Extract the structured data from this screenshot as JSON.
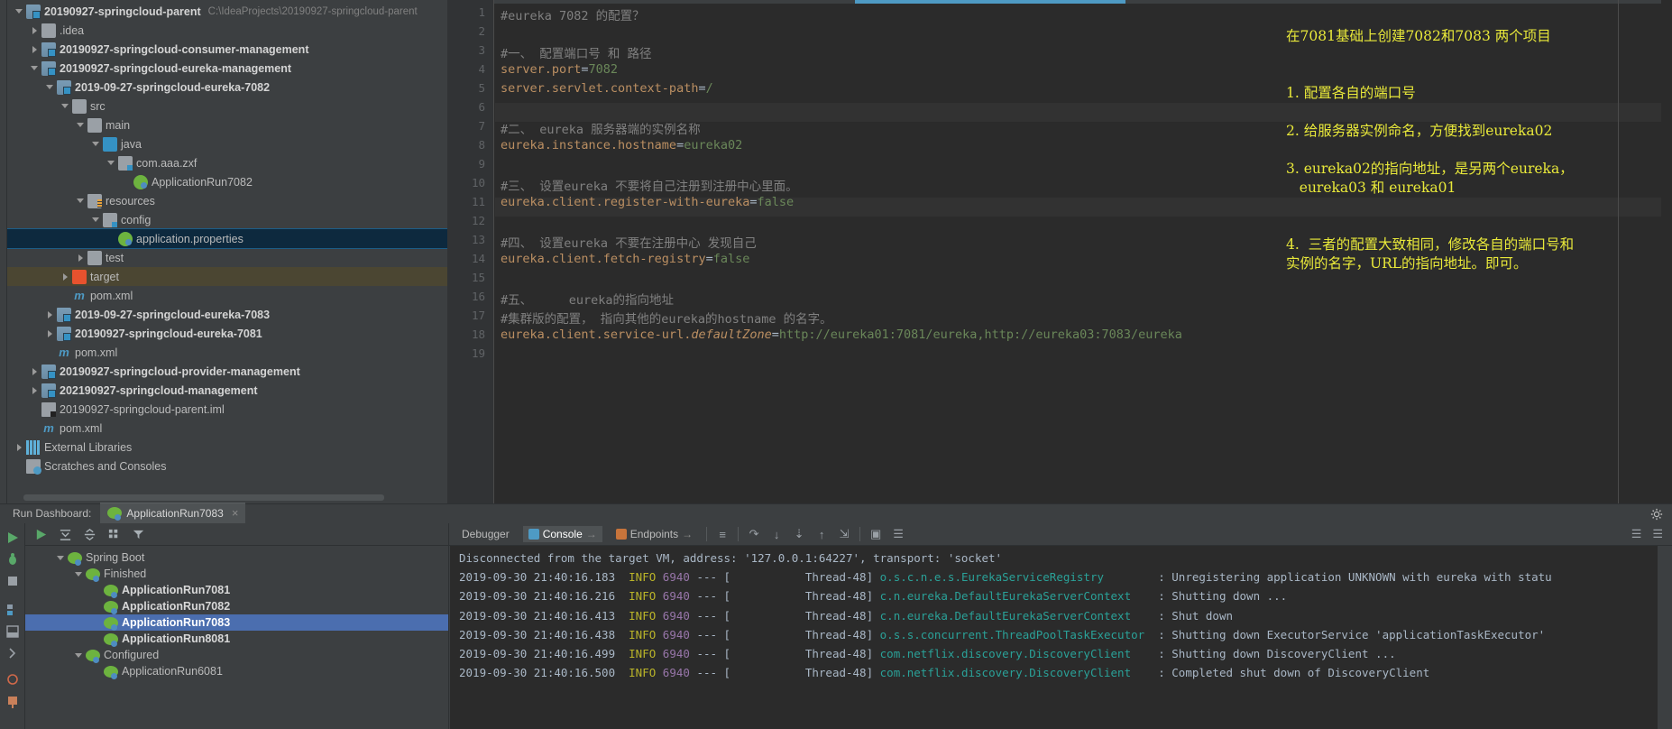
{
  "project_tree": [
    {
      "depth": 0,
      "twist": "d",
      "icon": "module-folder-icon",
      "label": "20190927-springcloud-parent",
      "bold": true,
      "path": "C:\\IdeaProjects\\20190927-springcloud-parent"
    },
    {
      "depth": 1,
      "twist": "r",
      "icon": "folder-icon",
      "label": ".idea",
      "bold": false
    },
    {
      "depth": 1,
      "twist": "r",
      "icon": "module-folder-icon",
      "label": "20190927-springcloud-consumer-management",
      "bold": true
    },
    {
      "depth": 1,
      "twist": "d",
      "icon": "module-folder-icon",
      "label": "20190927-springcloud-eureka-management",
      "bold": true
    },
    {
      "depth": 2,
      "twist": "d",
      "icon": "module-folder-icon",
      "label": "2019-09-27-springcloud-eureka-7082",
      "bold": true
    },
    {
      "depth": 3,
      "twist": "d",
      "icon": "folder-icon",
      "label": "src",
      "bold": false
    },
    {
      "depth": 4,
      "twist": "d",
      "icon": "folder-icon",
      "label": "main",
      "bold": false
    },
    {
      "depth": 5,
      "twist": "d",
      "icon": "java-source-folder-icon",
      "label": "java",
      "bold": false
    },
    {
      "depth": 6,
      "twist": "d",
      "icon": "package-icon",
      "label": "com.aaa.zxf",
      "bold": false
    },
    {
      "depth": 7,
      "twist": "",
      "icon": "spring-class-icon",
      "label": "ApplicationRun7082",
      "bold": false
    },
    {
      "depth": 4,
      "twist": "d",
      "icon": "resources-folder-icon",
      "label": "resources",
      "bold": false
    },
    {
      "depth": 5,
      "twist": "d",
      "icon": "package-icon",
      "label": "config",
      "bold": false
    },
    {
      "depth": 6,
      "twist": "",
      "icon": "properties-file-icon",
      "label": "application.properties",
      "bold": false,
      "state": "selected"
    },
    {
      "depth": 4,
      "twist": "r",
      "icon": "folder-icon",
      "label": "test",
      "bold": false
    },
    {
      "depth": 3,
      "twist": "r",
      "icon": "target-folder-icon",
      "label": "target",
      "bold": false,
      "state": "excluded"
    },
    {
      "depth": 3,
      "twist": "",
      "icon": "maven-pom-icon",
      "label": "pom.xml",
      "bold": false
    },
    {
      "depth": 2,
      "twist": "r",
      "icon": "module-folder-icon",
      "label": "2019-09-27-springcloud-eureka-7083",
      "bold": true
    },
    {
      "depth": 2,
      "twist": "r",
      "icon": "module-folder-icon",
      "label": "20190927-springcloud-eureka-7081",
      "bold": true
    },
    {
      "depth": 2,
      "twist": "",
      "icon": "maven-pom-icon",
      "label": "pom.xml",
      "bold": false
    },
    {
      "depth": 1,
      "twist": "r",
      "icon": "module-folder-icon",
      "label": "20190927-springcloud-provider-management",
      "bold": true
    },
    {
      "depth": 1,
      "twist": "r",
      "icon": "module-folder-icon",
      "label": "202190927-springcloud-management",
      "bold": true
    },
    {
      "depth": 1,
      "twist": "",
      "icon": "iml-file-icon",
      "label": "20190927-springcloud-parent.iml",
      "bold": false
    },
    {
      "depth": 1,
      "twist": "",
      "icon": "maven-pom-icon",
      "label": "pom.xml",
      "bold": false
    },
    {
      "depth": 0,
      "twist": "r",
      "icon": "external-libraries-icon",
      "label": "External Libraries",
      "bold": false
    },
    {
      "depth": 0,
      "twist": "",
      "icon": "scratches-icon",
      "label": "Scratches and Consoles",
      "bold": false
    }
  ],
  "editor": {
    "file": "application.properties",
    "line_numbers": [
      "1",
      "2",
      "3",
      "4",
      "5",
      "6",
      "7",
      "8",
      "9",
      "10",
      "11",
      "12",
      "13",
      "14",
      "15",
      "16",
      "17",
      "18",
      "19"
    ],
    "lines": [
      {
        "n": 1,
        "segments": [
          {
            "t": "#eureka 7082 的配置？",
            "c": "cmt"
          }
        ]
      },
      {
        "n": 2,
        "segments": []
      },
      {
        "n": 3,
        "segments": [
          {
            "t": "#一、 配置端口号 和 路径",
            "c": "cmt"
          }
        ]
      },
      {
        "n": 4,
        "segments": [
          {
            "t": "server.port",
            "c": "k-o"
          },
          {
            "t": "=",
            "c": "eq"
          },
          {
            "t": "7082",
            "c": "val"
          }
        ]
      },
      {
        "n": 5,
        "segments": [
          {
            "t": "server.servlet.context-path",
            "c": "k-o"
          },
          {
            "t": "=",
            "c": "eq"
          },
          {
            "t": "/",
            "c": "val"
          }
        ]
      },
      {
        "n": 6,
        "segments": []
      },
      {
        "n": 7,
        "segments": [
          {
            "t": "#二、 eureka 服务器端的实例名称",
            "c": "cmt"
          }
        ]
      },
      {
        "n": 8,
        "segments": [
          {
            "t": "eureka.instance.hostname",
            "c": "k-o"
          },
          {
            "t": "=",
            "c": "eq"
          },
          {
            "t": "eureka02",
            "c": "val"
          }
        ]
      },
      {
        "n": 9,
        "segments": []
      },
      {
        "n": 10,
        "segments": [
          {
            "t": "#三、 设置eureka 不要将自己注册到注册中心里面。",
            "c": "cmt"
          }
        ]
      },
      {
        "n": 11,
        "segments": [
          {
            "t": "eureka.client.register-with-eureka",
            "c": "k-o"
          },
          {
            "t": "=",
            "c": "eq"
          },
          {
            "t": "false",
            "c": "val"
          }
        ]
      },
      {
        "n": 12,
        "segments": []
      },
      {
        "n": 13,
        "segments": [
          {
            "t": "#四、 设置eureka 不要在注册中心 发现自己",
            "c": "cmt"
          }
        ]
      },
      {
        "n": 14,
        "segments": [
          {
            "t": "eureka.client.fetch-registry",
            "c": "k-o"
          },
          {
            "t": "=",
            "c": "eq"
          },
          {
            "t": "false",
            "c": "val"
          }
        ]
      },
      {
        "n": 15,
        "segments": []
      },
      {
        "n": 16,
        "segments": [
          {
            "t": "#五、     eureka的指向地址",
            "c": "cmt"
          }
        ]
      },
      {
        "n": 17,
        "segments": [
          {
            "t": "#集群版的配置， 指向其他的eureka的hostname 的名字。",
            "c": "cmt"
          }
        ]
      },
      {
        "n": 18,
        "segments": [
          {
            "t": "eureka.client.service-url.",
            "c": "k-o"
          },
          {
            "t": "defaultZone",
            "c": "ital"
          },
          {
            "t": "=",
            "c": "eq"
          },
          {
            "t": "http://eureka01:7081/eureka,http://eureka03:7083/eureka",
            "c": "val"
          }
        ]
      },
      {
        "n": 19,
        "segments": []
      }
    ],
    "annotations": [
      {
        "line": 2,
        "text": "在7081基础上创建7082和7083 两个项目"
      },
      {
        "line": 5,
        "text": "1. 配置各自的端口号"
      },
      {
        "line": 7,
        "text": "2. 给服务器实例命名，方便找到eureka02"
      },
      {
        "line": 9,
        "text": "3. eureka02的指向地址，是另两个eureka，"
      },
      {
        "line": 10,
        "text": "   eureka03 和 eureka01"
      },
      {
        "line": 13,
        "text": "4.  三者的配置大致相同，修改各自的端口号和"
      },
      {
        "line": 14,
        "text": "实例的名字，URL的指向地址。即可。"
      }
    ]
  },
  "run_dashboard": {
    "label": "Run Dashboard:",
    "tab": {
      "label": "ApplicationRun7083",
      "close": "×",
      "icon": "spring-boot-icon"
    },
    "toolbar": [
      {
        "name": "rerun-button",
        "glyph": "run-icon"
      },
      {
        "name": "expand-all-button",
        "glyph": "expand-all-icon"
      },
      {
        "name": "collapse-all-button",
        "glyph": "collapse-all-icon"
      },
      {
        "name": "group-button",
        "glyph": "group-icon"
      },
      {
        "name": "filter-button",
        "glyph": "filter-icon"
      }
    ],
    "tree": [
      {
        "depth": 0,
        "twist": "d",
        "icon": "spring-boot-icon",
        "label": "Spring Boot",
        "bold": false
      },
      {
        "depth": 1,
        "twist": "d",
        "icon": "finished-status-icon",
        "label": "Finished",
        "bold": false
      },
      {
        "depth": 2,
        "twist": "",
        "icon": "spring-boot-icon",
        "label": "ApplicationRun7081",
        "bold": true
      },
      {
        "depth": 2,
        "twist": "",
        "icon": "spring-boot-icon",
        "label": "ApplicationRun7082",
        "bold": true
      },
      {
        "depth": 2,
        "twist": "",
        "icon": "spring-boot-icon",
        "label": "ApplicationRun7083",
        "bold": true,
        "state": "selected"
      },
      {
        "depth": 2,
        "twist": "",
        "icon": "spring-boot-icon",
        "label": "ApplicationRun8081",
        "bold": true
      },
      {
        "depth": 1,
        "twist": "d",
        "icon": "configured-status-icon",
        "label": "Configured",
        "bold": false
      },
      {
        "depth": 2,
        "twist": "",
        "icon": "spring-boot-icon",
        "label": "ApplicationRun6081",
        "bold": false
      }
    ]
  },
  "console": {
    "tabs": [
      {
        "label": "Debugger",
        "active": false,
        "icon": ""
      },
      {
        "label": "Console",
        "active": true,
        "icon": "console-icon",
        "arrow": "→"
      },
      {
        "label": "Endpoints",
        "active": false,
        "icon": "endpoints-icon",
        "arrow": "→"
      }
    ],
    "toolbar_icons": [
      "list-icon",
      "step-over-icon",
      "step-into-icon",
      "force-step-into-icon",
      "step-out-icon",
      "drop-frame-icon",
      "evaluate-icon",
      "watches-icon"
    ],
    "right_icons": [
      "soft-wrap-icon",
      "scroll-end-icon"
    ],
    "header_line": "Disconnected from the target VM, address: '127.0.0.1:64227', transport: 'socket'",
    "log": [
      {
        "ts": "2019-09-30 21:40:16.183",
        "level": "INFO",
        "pid": "6940",
        "dash": "---",
        "thread": "[           Thread-48]",
        "cls": "o.s.c.n.e.s.EurekaServiceRegistry",
        "msg": ": Unregistering application UNKNOWN with eureka with statu"
      },
      {
        "ts": "2019-09-30 21:40:16.216",
        "level": "INFO",
        "pid": "6940",
        "dash": "---",
        "thread": "[           Thread-48]",
        "cls": "c.n.eureka.DefaultEurekaServerContext",
        "msg": ": Shutting down ..."
      },
      {
        "ts": "2019-09-30 21:40:16.413",
        "level": "INFO",
        "pid": "6940",
        "dash": "---",
        "thread": "[           Thread-48]",
        "cls": "c.n.eureka.DefaultEurekaServerContext",
        "msg": ": Shut down"
      },
      {
        "ts": "2019-09-30 21:40:16.438",
        "level": "INFO",
        "pid": "6940",
        "dash": "---",
        "thread": "[           Thread-48]",
        "cls": "o.s.s.concurrent.ThreadPoolTaskExecutor",
        "msg": ": Shutting down ExecutorService 'applicationTaskExecutor'"
      },
      {
        "ts": "2019-09-30 21:40:16.499",
        "level": "INFO",
        "pid": "6940",
        "dash": "---",
        "thread": "[           Thread-48]",
        "cls": "com.netflix.discovery.DiscoveryClient",
        "msg": ": Shutting down DiscoveryClient ..."
      },
      {
        "ts": "2019-09-30 21:40:16.500",
        "level": "INFO",
        "pid": "6940",
        "dash": "---",
        "thread": "[           Thread-48]",
        "cls": "com.netflix.discovery.DiscoveryClient",
        "msg": ": Completed shut down of DiscoveryClient"
      }
    ]
  },
  "left_tool_strip": [
    "run-icon",
    "debug-icon",
    "stop-icon",
    "structure-icon",
    "restore-layout-icon",
    "expand-icon",
    "settings-icon",
    "pin-icon"
  ],
  "colors": {
    "bg": "#3c3f41",
    "editor_bg": "#2b2b2b",
    "selection": "#0d293e",
    "accent": "#4e9ac4",
    "annotation": "#e9e93a",
    "excluded": "#4b4632",
    "run_selected": "#4b6eaf"
  }
}
